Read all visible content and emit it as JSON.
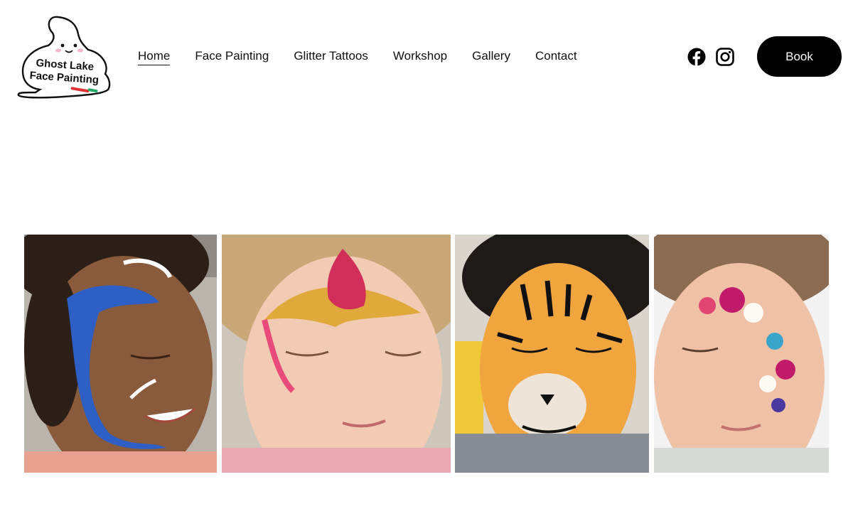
{
  "brand": {
    "logo_line1": "Ghost Lake",
    "logo_line2": "Face Painting"
  },
  "nav": {
    "items": [
      {
        "label": "Home",
        "active": true
      },
      {
        "label": "Face Painting",
        "active": false
      },
      {
        "label": "Glitter Tattoos",
        "active": false
      },
      {
        "label": "Workshop",
        "active": false
      },
      {
        "label": "Gallery",
        "active": false
      },
      {
        "label": "Contact",
        "active": false
      }
    ]
  },
  "social": {
    "icons": [
      "facebook-icon",
      "instagram-icon"
    ]
  },
  "cta": {
    "book_label": "Book"
  },
  "gallery": {
    "photos": [
      {
        "subject": "dolphin-face-paint"
      },
      {
        "subject": "princess-crown-face-paint"
      },
      {
        "subject": "tiger-face-paint"
      },
      {
        "subject": "flower-face-paint"
      }
    ]
  },
  "colors": {
    "button_bg": "#000000",
    "button_text": "#ffffff",
    "text": "#111111",
    "background": "#ffffff"
  }
}
